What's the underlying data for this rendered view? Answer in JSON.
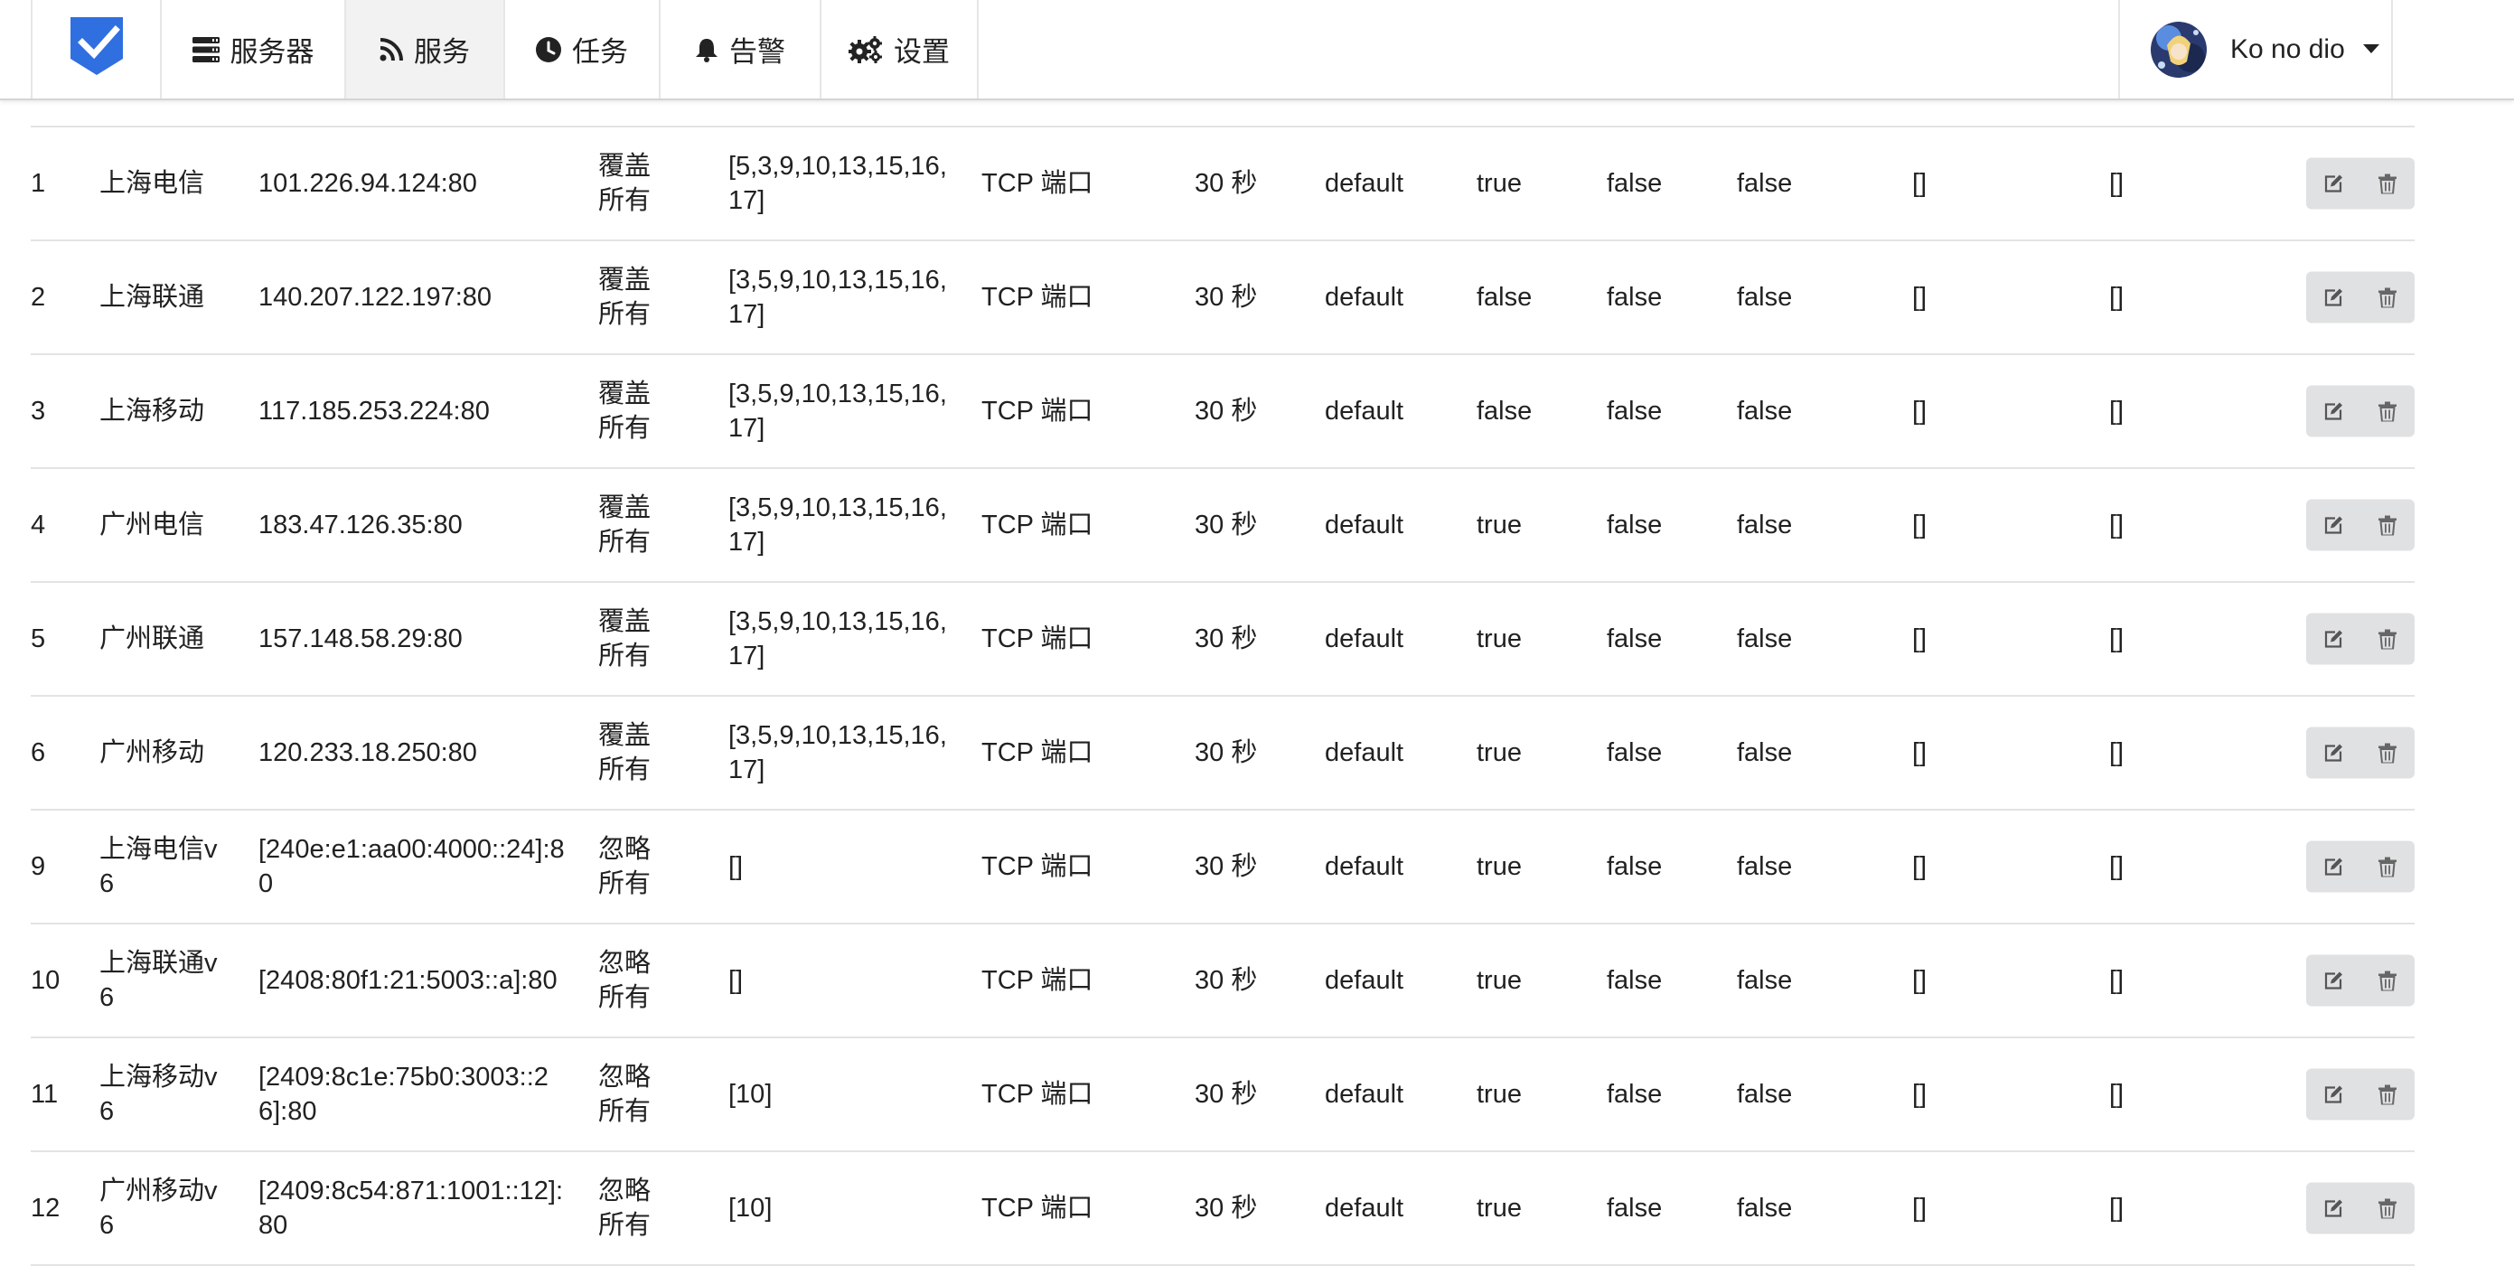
{
  "nav": {
    "logo_icon": "shield-check-logo",
    "items": [
      {
        "label": "服务器",
        "icon": "server-icon"
      },
      {
        "label": "服务",
        "icon": "rss-icon",
        "active": true
      },
      {
        "label": "任务",
        "icon": "clock-icon"
      },
      {
        "label": "告警",
        "icon": "bell-icon"
      },
      {
        "label": "设置",
        "icon": "cogs-icon"
      }
    ]
  },
  "user": {
    "name": "Ko no dio",
    "avatar_icon": "avatar"
  },
  "colors": {
    "logo": "#2f6fe0",
    "active_nav_bg": "#f2f2f2",
    "button_bg": "#e0e1e2",
    "divider": "#e3e3e4"
  },
  "table": {
    "rows": [
      {
        "id": "1",
        "name": "上海电信",
        "target": "101.226.94.124:80",
        "cover": "覆盖所有",
        "servers": "[5,3,9,10,13,15,16,17]",
        "type": "TCP 端口",
        "duration": "30 秒",
        "notif_group": "default",
        "notify": "true",
        "cost": "false",
        "hide": "false",
        "fail_task": "[]",
        "recover_task": "[]"
      },
      {
        "id": "2",
        "name": "上海联通",
        "target": "140.207.122.197:80",
        "cover": "覆盖所有",
        "servers": "[3,5,9,10,13,15,16,17]",
        "type": "TCP 端口",
        "duration": "30 秒",
        "notif_group": "default",
        "notify": "false",
        "cost": "false",
        "hide": "false",
        "fail_task": "[]",
        "recover_task": "[]"
      },
      {
        "id": "3",
        "name": "上海移动",
        "target": "117.185.253.224:80",
        "cover": "覆盖所有",
        "servers": "[3,5,9,10,13,15,16,17]",
        "type": "TCP 端口",
        "duration": "30 秒",
        "notif_group": "default",
        "notify": "false",
        "cost": "false",
        "hide": "false",
        "fail_task": "[]",
        "recover_task": "[]"
      },
      {
        "id": "4",
        "name": "广州电信",
        "target": "183.47.126.35:80",
        "cover": "覆盖所有",
        "servers": "[3,5,9,10,13,15,16,17]",
        "type": "TCP 端口",
        "duration": "30 秒",
        "notif_group": "default",
        "notify": "true",
        "cost": "false",
        "hide": "false",
        "fail_task": "[]",
        "recover_task": "[]"
      },
      {
        "id": "5",
        "name": "广州联通",
        "target": "157.148.58.29:80",
        "cover": "覆盖所有",
        "servers": "[3,5,9,10,13,15,16,17]",
        "type": "TCP 端口",
        "duration": "30 秒",
        "notif_group": "default",
        "notify": "true",
        "cost": "false",
        "hide": "false",
        "fail_task": "[]",
        "recover_task": "[]"
      },
      {
        "id": "6",
        "name": "广州移动",
        "target": "120.233.18.250:80",
        "cover": "覆盖所有",
        "servers": "[3,5,9,10,13,15,16,17]",
        "type": "TCP 端口",
        "duration": "30 秒",
        "notif_group": "default",
        "notify": "true",
        "cost": "false",
        "hide": "false",
        "fail_task": "[]",
        "recover_task": "[]"
      },
      {
        "id": "9",
        "name": "上海电信v6",
        "target": "[240e:e1:aa00:4000::24]:80",
        "cover": "忽略所有",
        "servers": "[]",
        "type": "TCP 端口",
        "duration": "30 秒",
        "notif_group": "default",
        "notify": "true",
        "cost": "false",
        "hide": "false",
        "fail_task": "[]",
        "recover_task": "[]"
      },
      {
        "id": "10",
        "name": "上海联通v6",
        "target": "[2408:80f1:21:5003::a]:80",
        "cover": "忽略所有",
        "servers": "[]",
        "type": "TCP 端口",
        "duration": "30 秒",
        "notif_group": "default",
        "notify": "true",
        "cost": "false",
        "hide": "false",
        "fail_task": "[]",
        "recover_task": "[]"
      },
      {
        "id": "11",
        "name": "上海移动v6",
        "target": "[2409:8c1e:75b0:3003::26]:80",
        "cover": "忽略所有",
        "servers": "[10]",
        "type": "TCP 端口",
        "duration": "30 秒",
        "notif_group": "default",
        "notify": "true",
        "cost": "false",
        "hide": "false",
        "fail_task": "[]",
        "recover_task": "[]"
      },
      {
        "id": "12",
        "name": "广州移动v6",
        "target": "[2409:8c54:871:1001::12]:80",
        "cover": "忽略所有",
        "servers": "[10]",
        "type": "TCP 端口",
        "duration": "30 秒",
        "notif_group": "default",
        "notify": "true",
        "cost": "false",
        "hide": "false",
        "fail_task": "[]",
        "recover_task": "[]"
      }
    ],
    "row_actions": [
      {
        "icon": "edit-icon"
      },
      {
        "icon": "trash-icon"
      }
    ]
  }
}
